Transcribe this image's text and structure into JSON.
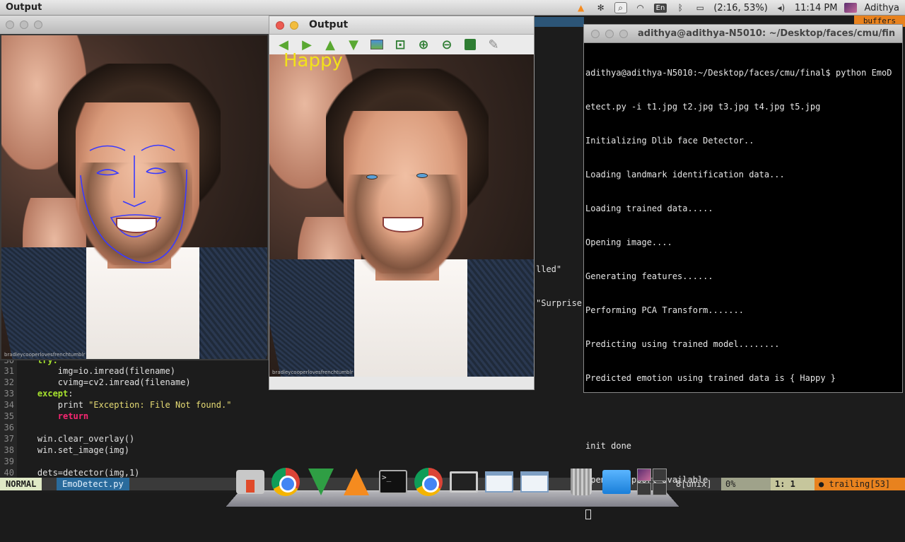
{
  "menubar": {
    "app_name": "Output",
    "battery": "(2:16, 53%)",
    "lang": "En",
    "clock": "11:14 PM",
    "user": "Adithya",
    "icons": [
      "vlc-icon",
      "gear-icon",
      "search-icon",
      "wifi-icon",
      "bluetooth-icon",
      "battery-icon",
      "volume-icon"
    ]
  },
  "vim": {
    "buffers_label": "buffers",
    "fragments": {
      "frag1": "lled\"",
      "frag2": "\"Surprise"
    },
    "lines": [
      {
        "n": "30",
        "text": "    try:"
      },
      {
        "n": "31",
        "text": "        img=io.imread(filename)"
      },
      {
        "n": "32",
        "text": "        cvimg=cv2.imread(filename)"
      },
      {
        "n": "33",
        "kw": "except",
        "text": ":"
      },
      {
        "n": "34",
        "pre": "        print ",
        "str": "\"Exception: File Not found.\""
      },
      {
        "n": "35",
        "ret": "return"
      },
      {
        "n": "36",
        "text": ""
      },
      {
        "n": "37",
        "text": "    win.clear_overlay()"
      },
      {
        "n": "38",
        "text": "    win.set_image(img)"
      },
      {
        "n": "39",
        "text": ""
      },
      {
        "n": "40",
        "text": "    dets=detector(img,1)"
      }
    ],
    "status": {
      "mode": "NORMAL",
      "filename": "EmoDetect.py",
      "fileformat": "8[unix]",
      "percent": "0%",
      "position": "1:  1",
      "trailing": "trailing[53]"
    }
  },
  "output_window": {
    "title": "Output",
    "emotion_label": "Happy",
    "toolbar": [
      "back-arrow-icon",
      "forward-arrow-icon",
      "up-arrow-icon",
      "down-arrow-icon",
      "image-icon",
      "zoom-fit-icon",
      "zoom-in-icon",
      "zoom-out-icon",
      "save-icon",
      "settings-icon"
    ],
    "watermark": "bradleycooperlovesfrenchtumblr"
  },
  "left_window": {
    "watermark": "bradleycooperlovesfrenchtumblr"
  },
  "terminal": {
    "title": "adithya@adithya-N5010: ~/Desktop/faces/cmu/fin",
    "lines": [
      "adithya@adithya-N5010:~/Desktop/faces/cmu/final$ python EmoD",
      "etect.py -i t1.jpg t2.jpg t3.jpg t4.jpg t5.jpg",
      "Initializing Dlib face Detector..",
      "Loading landmark identification data...",
      "Loading trained data.....",
      "Opening image....",
      "Generating features......",
      "Performing PCA Transform.......",
      "Predicting using trained model........",
      "Predicted emotion using trained data is { Happy }",
      "",
      "init done",
      "opengl support available"
    ]
  },
  "dock": {
    "items": [
      "finder-icon",
      "chrome-icon",
      "vim-icon",
      "vlc-icon",
      "terminal-icon",
      "chrome-icon",
      "monitor-icon",
      "window-icon",
      "window-icon",
      "trash-icon",
      "folder-icon",
      "workspace-icon"
    ]
  },
  "colors": {
    "label_yellow": "#f2e21a",
    "landmark_blue": "#3a3aff",
    "vim_bg": "#1c1c1c",
    "status_orange": "#e8821e"
  }
}
